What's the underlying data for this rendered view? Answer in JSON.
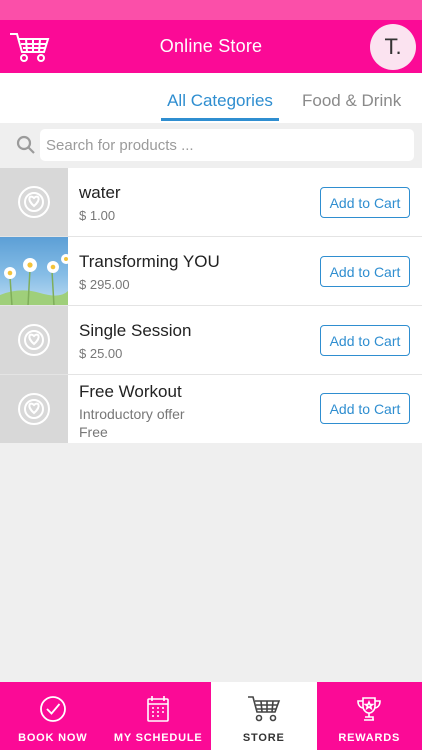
{
  "header": {
    "title": "Online Store",
    "avatar_initial": "T."
  },
  "tabs": [
    {
      "label": "All Categories",
      "active": true
    },
    {
      "label": "Food & Drink",
      "active": false
    }
  ],
  "search": {
    "placeholder": "Search for products ..."
  },
  "products": [
    {
      "name": "water",
      "subtitle": "",
      "price": "$ 1.00",
      "button": "Add to Cart",
      "thumb": "placeholder-logo"
    },
    {
      "name": "Transforming YOU",
      "subtitle": "",
      "price": "$ 295.00",
      "button": "Add to Cart",
      "thumb": "daisies-photo"
    },
    {
      "name": "Single Session",
      "subtitle": "",
      "price": "$ 25.00",
      "button": "Add to Cart",
      "thumb": "placeholder-logo"
    },
    {
      "name": "Free Workout",
      "subtitle": "Introductory offer",
      "price": "Free",
      "button": "Add to Cart",
      "thumb": "placeholder-logo"
    }
  ],
  "nav": [
    {
      "label": "BOOK NOW",
      "icon": "check-circle-icon",
      "active": false
    },
    {
      "label": "MY SCHEDULE",
      "icon": "calendar-icon",
      "active": false
    },
    {
      "label": "STORE",
      "icon": "cart-icon",
      "active": true
    },
    {
      "label": "REWARDS",
      "icon": "trophy-icon",
      "active": false
    }
  ],
  "colors": {
    "brand_pink": "#fb0a96",
    "status_pink": "#fb4fa9",
    "accent_blue": "#2f8ed0"
  }
}
